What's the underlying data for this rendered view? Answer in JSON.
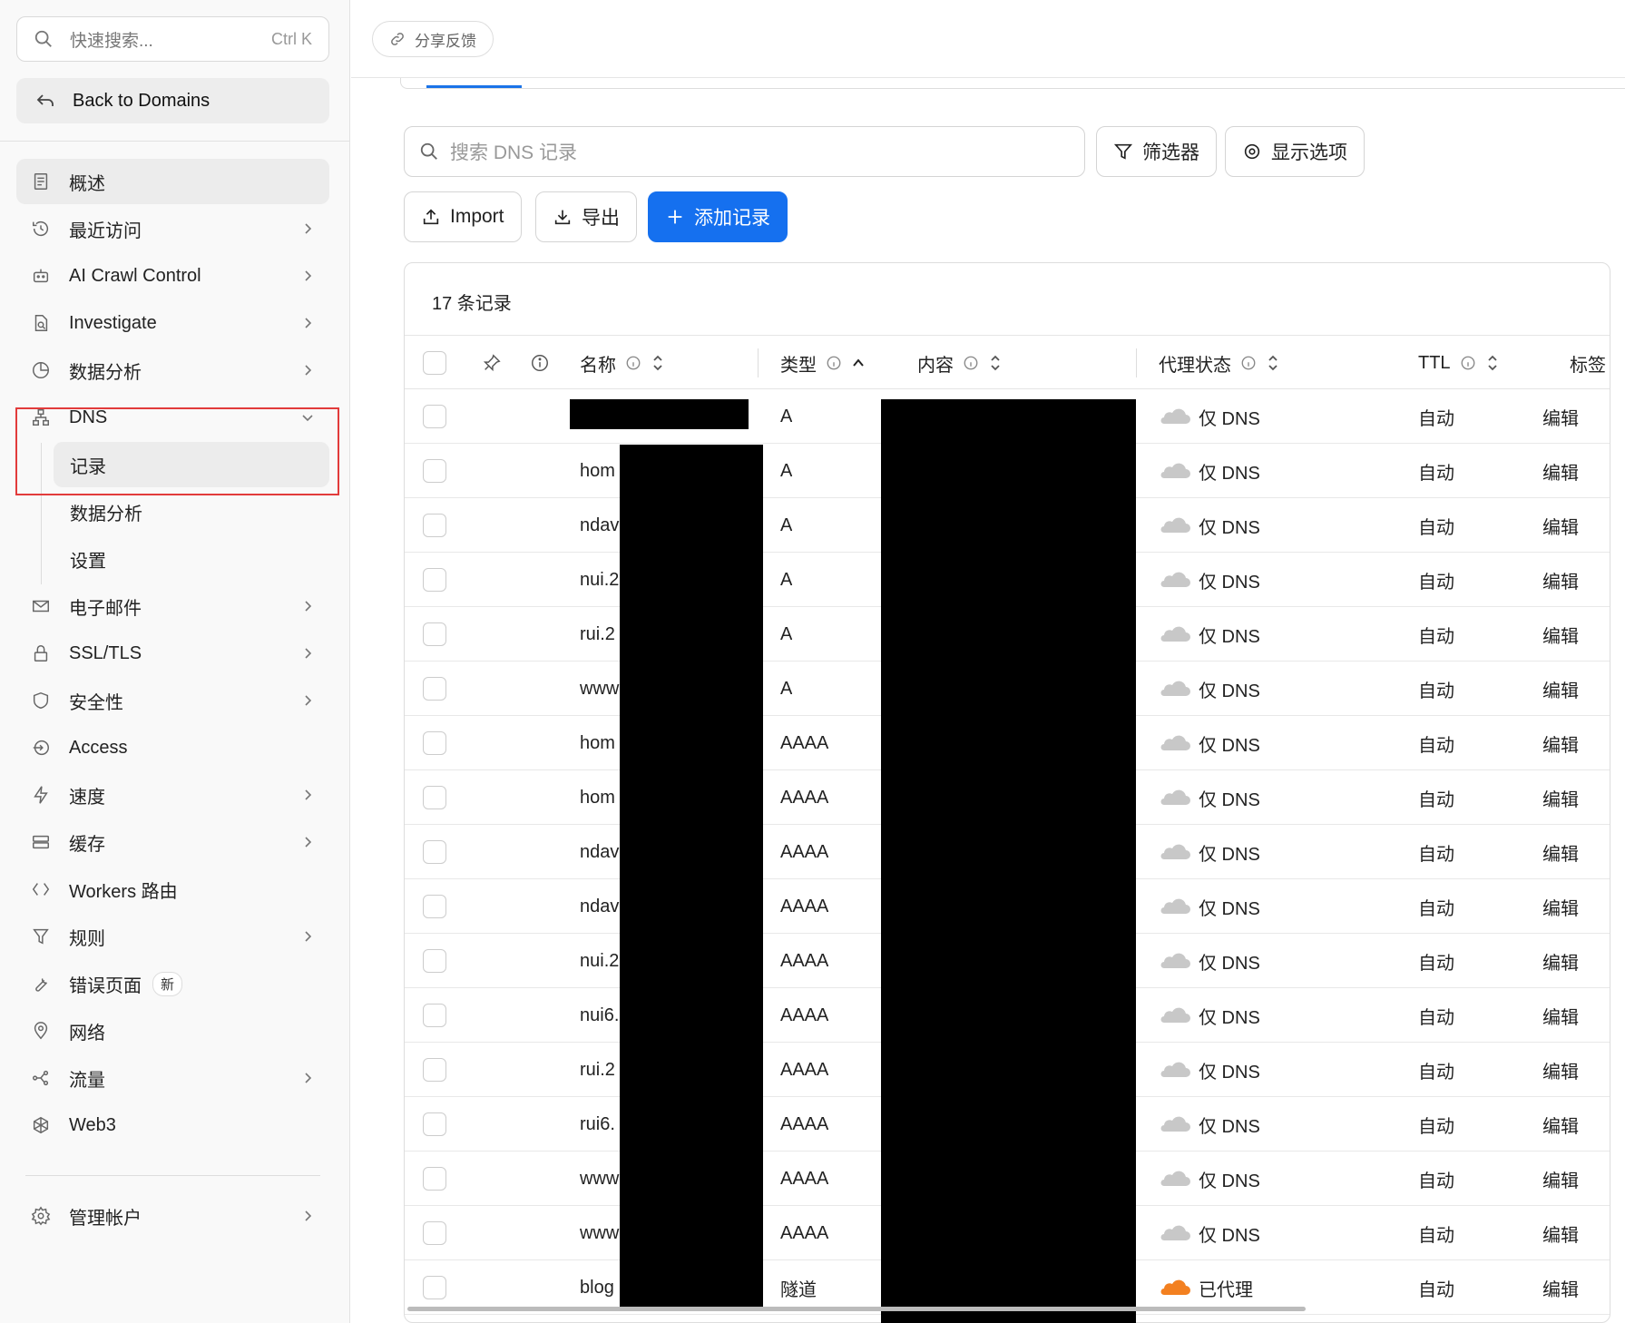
{
  "sidebar": {
    "search_placeholder": "快速搜索...",
    "search_shortcut": "Ctrl K",
    "back_label": "Back to Domains",
    "items": [
      {
        "label": "概述",
        "icon": "document-icon",
        "chevron": false,
        "active": true
      },
      {
        "label": "最近访问",
        "icon": "history-icon",
        "chevron": true
      },
      {
        "label": "AI Crawl Control",
        "icon": "robot-icon",
        "chevron": true
      },
      {
        "label": "Investigate",
        "icon": "investigate-icon",
        "chevron": true
      },
      {
        "label": "数据分析",
        "icon": "pie-chart-icon",
        "chevron": true
      },
      {
        "label": "DNS",
        "icon": "network-icon",
        "chevron": "down"
      },
      {
        "label": "电子邮件",
        "icon": "mail-icon",
        "chevron": true
      },
      {
        "label": "SSL/TLS",
        "icon": "lock-icon",
        "chevron": true
      },
      {
        "label": "安全性",
        "icon": "shield-icon",
        "chevron": true
      },
      {
        "label": "Access",
        "icon": "login-icon",
        "chevron": false
      },
      {
        "label": "速度",
        "icon": "lightning-icon",
        "chevron": true
      },
      {
        "label": "缓存",
        "icon": "storage-icon",
        "chevron": true
      },
      {
        "label": "Workers 路由",
        "icon": "code-icon",
        "chevron": false
      },
      {
        "label": "规则",
        "icon": "funnel-icon",
        "chevron": true
      },
      {
        "label": "错误页面",
        "icon": "wrench-icon",
        "chevron": false,
        "badge": "新"
      },
      {
        "label": "网络",
        "icon": "location-icon",
        "chevron": false
      },
      {
        "label": "流量",
        "icon": "traffic-icon",
        "chevron": true
      },
      {
        "label": "Web3",
        "icon": "web3-icon",
        "chevron": false
      }
    ],
    "dns_sub": [
      {
        "label": "记录",
        "active": true
      },
      {
        "label": "数据分析"
      },
      {
        "label": "设置"
      }
    ],
    "account": {
      "label": "管理帐户",
      "icon": "gear-icon"
    }
  },
  "topbar": {
    "share_label": "分享反馈"
  },
  "toolbar": {
    "search_placeholder": "搜索 DNS 记录",
    "filter_label": "筛选器",
    "display_label": "显示选项",
    "import_label": "Import",
    "export_label": "导出",
    "add_label": "添加记录"
  },
  "table": {
    "count_label": "17 条记录",
    "headers": {
      "name": "名称",
      "type": "类型",
      "content": "内容",
      "proxy": "代理状态",
      "ttl": "TTL",
      "tags": "标签"
    },
    "rows": [
      {
        "name": "",
        "type": "A",
        "proxy": "仅 DNS",
        "proxied": false,
        "ttl": "自动",
        "action": "编辑"
      },
      {
        "name": "hom",
        "type": "A",
        "proxy": "仅 DNS",
        "proxied": false,
        "ttl": "自动",
        "action": "编辑"
      },
      {
        "name": "ndav",
        "type": "A",
        "proxy": "仅 DNS",
        "proxied": false,
        "ttl": "自动",
        "action": "编辑"
      },
      {
        "name": "nui.2",
        "type": "A",
        "proxy": "仅 DNS",
        "proxied": false,
        "ttl": "自动",
        "action": "编辑"
      },
      {
        "name": "rui.2",
        "type": "A",
        "proxy": "仅 DNS",
        "proxied": false,
        "ttl": "自动",
        "action": "编辑"
      },
      {
        "name": "www",
        "type": "A",
        "proxy": "仅 DNS",
        "proxied": false,
        "ttl": "自动",
        "action": "编辑"
      },
      {
        "name": "hom",
        "type": "AAAA",
        "proxy": "仅 DNS",
        "proxied": false,
        "ttl": "自动",
        "action": "编辑"
      },
      {
        "name": "hom",
        "type": "AAAA",
        "proxy": "仅 DNS",
        "proxied": false,
        "ttl": "自动",
        "action": "编辑"
      },
      {
        "name": "ndav",
        "type": "AAAA",
        "proxy": "仅 DNS",
        "proxied": false,
        "ttl": "自动",
        "action": "编辑"
      },
      {
        "name": "ndav",
        "type": "AAAA",
        "proxy": "仅 DNS",
        "proxied": false,
        "ttl": "自动",
        "action": "编辑"
      },
      {
        "name": "nui.2",
        "type": "AAAA",
        "proxy": "仅 DNS",
        "proxied": false,
        "ttl": "自动",
        "action": "编辑"
      },
      {
        "name": "nui6.",
        "type": "AAAA",
        "proxy": "仅 DNS",
        "proxied": false,
        "ttl": "自动",
        "action": "编辑"
      },
      {
        "name": "rui.2",
        "type": "AAAA",
        "proxy": "仅 DNS",
        "proxied": false,
        "ttl": "自动",
        "action": "编辑"
      },
      {
        "name": "rui6.",
        "type": "AAAA",
        "proxy": "仅 DNS",
        "proxied": false,
        "ttl": "自动",
        "action": "编辑"
      },
      {
        "name": "www",
        "type": "AAAA",
        "proxy": "仅 DNS",
        "proxied": false,
        "ttl": "自动",
        "action": "编辑"
      },
      {
        "name": "www",
        "type": "AAAA",
        "proxy": "仅 DNS",
        "proxied": false,
        "ttl": "自动",
        "action": "编辑"
      },
      {
        "name": "blog",
        "type": "隧道",
        "proxy": "已代理",
        "proxied": true,
        "ttl": "自动",
        "action": "编辑"
      }
    ]
  },
  "colors": {
    "accent": "#1570ef",
    "proxied_cloud": "#f38020",
    "dns_only_cloud": "#c8c8c8",
    "highlight_border": "#e23b3b"
  }
}
